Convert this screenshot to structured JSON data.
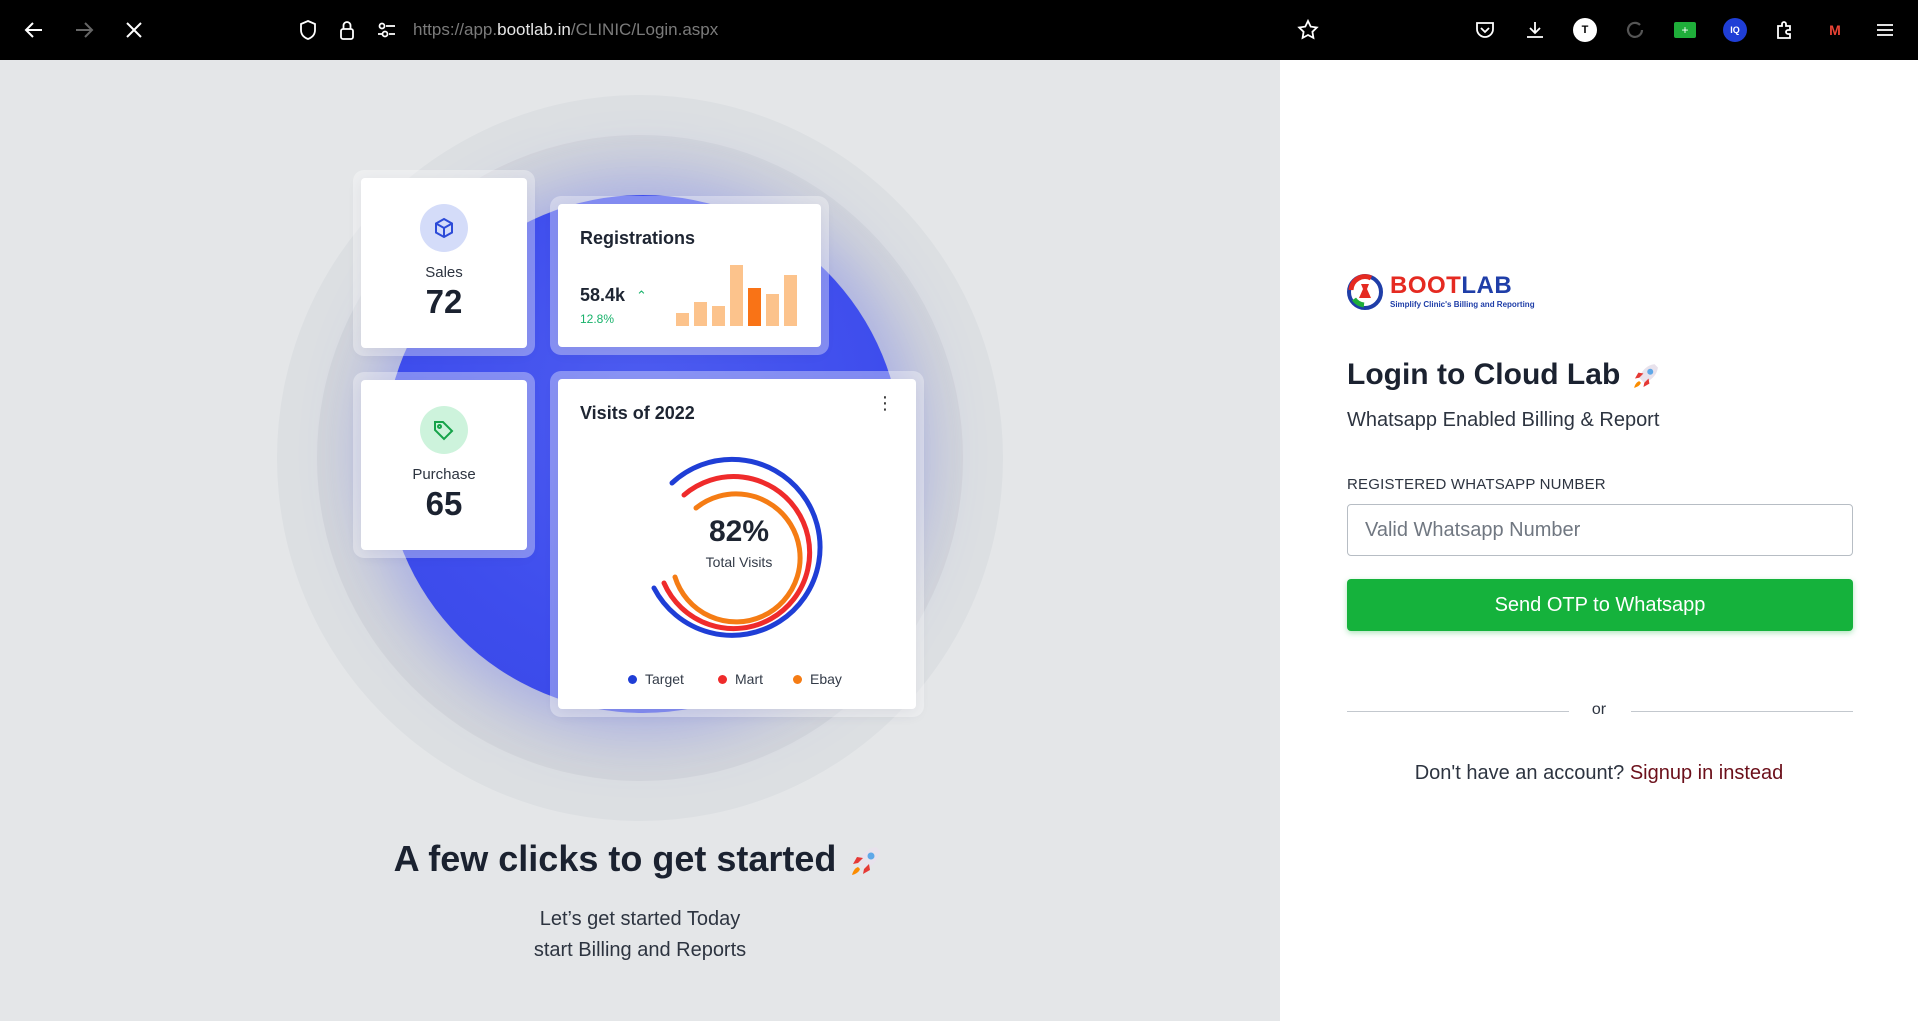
{
  "browser": {
    "url_prefix": "https://app.",
    "url_host": "bootlab.in",
    "url_path": "/CLINIC/Login.aspx",
    "extension_t_label": "T",
    "extension_iq_label": "IQ",
    "extension_m_label": "M"
  },
  "dashboard": {
    "sales_label": "Sales",
    "sales_value": "72",
    "purchase_label": "Purchase",
    "purchase_value": "65",
    "registrations_title": "Registrations",
    "registrations_value": "58.4k",
    "registrations_change": "12.8%",
    "registrations_bars": [
      0.2,
      0.38,
      0.32,
      0.95,
      0.6,
      0.5,
      0.8
    ],
    "registrations_bar_colors": [
      "#fcc38c",
      "#fcc38c",
      "#fcc38c",
      "#fcc38c",
      "#f97316",
      "#fcc38c",
      "#fcc38c"
    ],
    "visits_title": "Visits of 2022",
    "visits_percent": "82%",
    "visits_caption": "Total Visits",
    "legend": [
      {
        "label": "Target",
        "color": "#1f3ed6"
      },
      {
        "label": "Mart",
        "color": "#ef2b2b"
      },
      {
        "label": "Ebay",
        "color": "#f57c14"
      }
    ]
  },
  "hero": {
    "title": "A few clicks to get started",
    "subtitle_line1": "Let’s get started Today",
    "subtitle_line2": "start Billing and Reports"
  },
  "login": {
    "logo_part1": "BOOT",
    "logo_part2": "LAB",
    "logo_tagline": "Simplify Clinic's Billing and Reporting",
    "title": "Login to Cloud Lab",
    "subtitle": "Whatsapp Enabled Billing & Report",
    "field_label": "REGISTERED WHATSAPP NUMBER",
    "field_placeholder": "Valid Whatsapp Number",
    "button_label": "Send OTP to Whatsapp",
    "divider_text": "or",
    "signup_prompt": "Don't have an account?",
    "signup_link": "Signup in instead"
  },
  "colors": {
    "primary_green": "#15b23c",
    "brand_blue": "#3e4ded",
    "signup_link": "#6b0f1a"
  }
}
